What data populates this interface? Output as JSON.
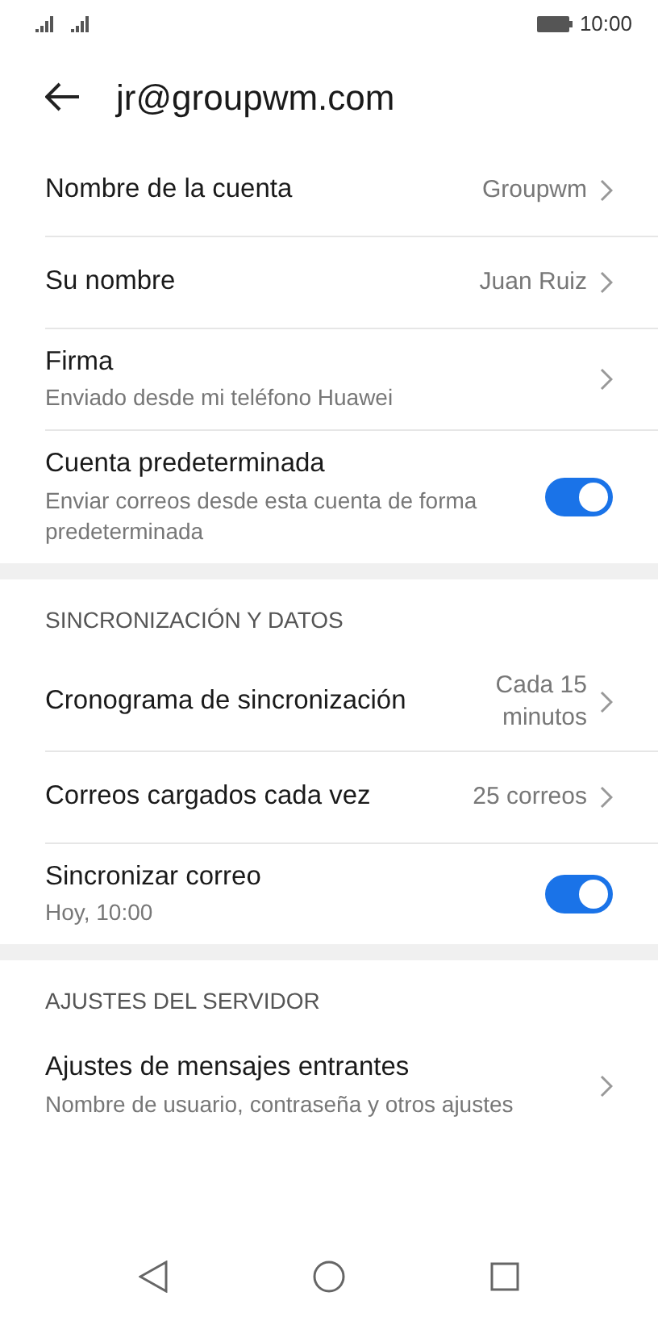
{
  "status_bar": {
    "time": "10:00"
  },
  "header": {
    "title": "jr@groupwm.com"
  },
  "sections": [
    {
      "items": [
        {
          "kind": "link",
          "title": "Nombre de la cuenta",
          "value": "Groupwm"
        },
        {
          "kind": "link",
          "title": "Su nombre",
          "value": "Juan Ruiz"
        },
        {
          "kind": "link",
          "title": "Firma",
          "subtitle": "Enviado desde mi teléfono Huawei"
        },
        {
          "kind": "toggle",
          "title": "Cuenta predeterminada",
          "subtitle": "Enviar correos desde esta cuenta de forma predeterminada",
          "on": true
        }
      ]
    },
    {
      "heading": "SINCRONIZACIÓN Y DATOS",
      "items": [
        {
          "kind": "link",
          "title": "Cronograma de sincronización",
          "value": "Cada 15 minutos"
        },
        {
          "kind": "link",
          "title": "Correos cargados cada vez",
          "value": "25 correos"
        },
        {
          "kind": "toggle",
          "title": "Sincronizar correo",
          "subtitle": "Hoy, 10:00",
          "on": true
        }
      ]
    },
    {
      "heading": "AJUSTES DEL SERVIDOR",
      "items": [
        {
          "kind": "link",
          "title": "Ajustes de mensajes entrantes",
          "subtitle": "Nombre de usuario, contraseña y otros ajustes"
        }
      ]
    }
  ]
}
